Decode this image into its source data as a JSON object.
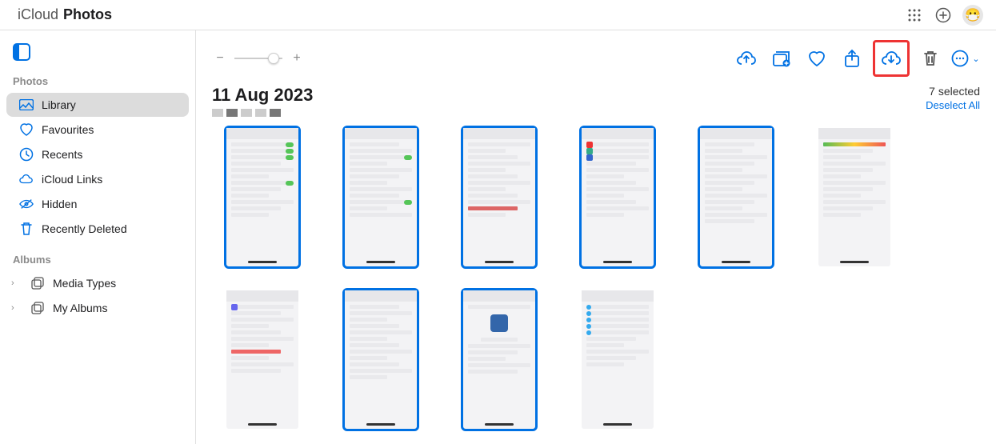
{
  "app": {
    "brand": "iCloud",
    "product": "Photos"
  },
  "topbar_icons": [
    "apps-grid-icon",
    "add-circle-icon",
    "avatar-icon"
  ],
  "avatar_emoji": "😷",
  "sidebar": {
    "sections": [
      {
        "title": "Photos",
        "items": [
          {
            "id": "library",
            "label": "Library",
            "icon": "photos-icon",
            "selected": true
          },
          {
            "id": "favourites",
            "label": "Favourites",
            "icon": "heart-icon"
          },
          {
            "id": "recents",
            "label": "Recents",
            "icon": "clock-icon"
          },
          {
            "id": "icloud-links",
            "label": "iCloud Links",
            "icon": "cloud-link-icon"
          },
          {
            "id": "hidden",
            "label": "Hidden",
            "icon": "eye-slash-icon"
          },
          {
            "id": "recently-deleted",
            "label": "Recently Deleted",
            "icon": "trash-icon"
          }
        ]
      },
      {
        "title": "Albums",
        "items": [
          {
            "id": "media-types",
            "label": "Media Types",
            "icon": "stack-icon",
            "expandable": true
          },
          {
            "id": "my-albums",
            "label": "My Albums",
            "icon": "stack-icon",
            "expandable": true
          }
        ]
      }
    ]
  },
  "toolbar": {
    "zoom_minus": "−",
    "zoom_plus": "+",
    "actions": [
      {
        "id": "upload",
        "name": "upload-cloud-icon"
      },
      {
        "id": "add-album",
        "name": "add-to-album-icon"
      },
      {
        "id": "favourite",
        "name": "heart-outline-icon"
      },
      {
        "id": "share",
        "name": "share-icon"
      },
      {
        "id": "download",
        "name": "download-cloud-icon",
        "highlighted": true
      },
      {
        "id": "delete",
        "name": "trash-action-icon",
        "danger": true
      },
      {
        "id": "more",
        "name": "ellipsis-circle-icon",
        "chevron": true
      }
    ]
  },
  "view": {
    "date_heading": "11 Aug 2023",
    "selected_count_label": "7 selected",
    "deselect_label": "Deselect All",
    "breadcrumb_levels": 5,
    "breadcrumb_active_index": 4
  },
  "photos_row1": [
    {
      "selected": true
    },
    {
      "selected": true
    },
    {
      "selected": true
    },
    {
      "selected": true
    },
    {
      "selected": true
    }
  ],
  "photos_row2": [
    {
      "selected": false
    },
    {
      "selected": false
    },
    {
      "selected": true
    },
    {
      "selected": true
    },
    {
      "selected": false
    }
  ]
}
